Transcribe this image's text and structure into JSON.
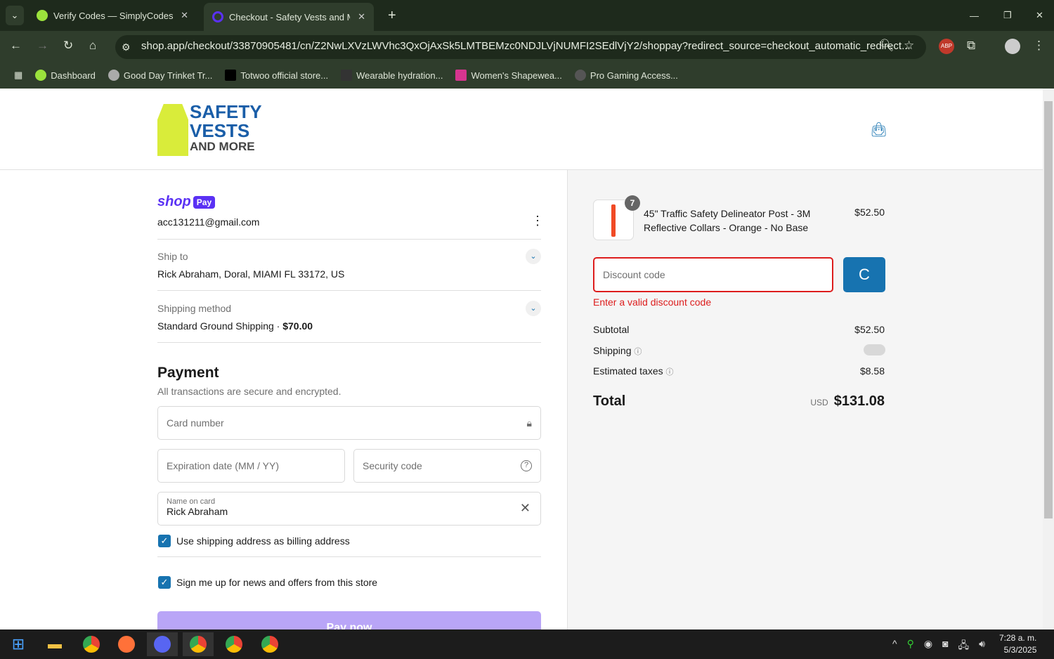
{
  "browser": {
    "tabs": [
      {
        "title": "Verify Codes — SimplyCodes",
        "active": false
      },
      {
        "title": "Checkout - Safety Vests and Mo",
        "active": true
      }
    ],
    "url": "shop.app/checkout/33870905481/cn/Z2NwLXVzLWVhc3QxOjAxSk5LMTBEMzc0NDJLVjNUMFI2SEdlVjY2/shoppay?redirect_source=checkout_automatic_redirect...",
    "bookmarks": [
      "Dashboard",
      "Good Day Trinket Tr...",
      "Totwoo official store...",
      "Wearable hydration...",
      "Women's Shapewea...",
      "Pro Gaming Access..."
    ]
  },
  "store": {
    "logo_line1": "SAFETY",
    "logo_line2": "VESTS",
    "logo_line3": "AND MORE"
  },
  "shoppay": {
    "brand": "shop",
    "badge": "Pay",
    "email": "acc131211@gmail.com"
  },
  "ship_to": {
    "label": "Ship to",
    "value": "Rick Abraham, Doral, MIAMI FL 33172, US"
  },
  "shipping_method": {
    "label": "Shipping method",
    "value": "Standard Ground Shipping · ",
    "price": "$70.00"
  },
  "payment": {
    "title": "Payment",
    "subtitle": "All transactions are secure and encrypted.",
    "card_placeholder": "Card number",
    "expiry_placeholder": "Expiration date (MM / YY)",
    "security_placeholder": "Security code",
    "name_label": "Name on card",
    "name_value": "Rick Abraham",
    "billing_checkbox": "Use shipping address as billing address",
    "news_checkbox": "Sign me up for news and offers from this store",
    "pay_button": "Pay now"
  },
  "summary": {
    "item": {
      "qty": "7",
      "title": "45\" Traffic Safety Delineator Post - 3M Reflective Collars - Orange - No Base",
      "price": "$52.50"
    },
    "discount_placeholder": "Discount code",
    "discount_error": "Enter a valid discount code",
    "subtotal_label": "Subtotal",
    "subtotal": "$52.50",
    "shipping_label": "Shipping",
    "taxes_label": "Estimated taxes",
    "taxes": "$8.58",
    "total_label": "Total",
    "currency": "USD",
    "total": "$131.08"
  },
  "colors": {
    "accent": "#1773b0",
    "error": "#dd1d1d",
    "pay_button": "#b9a5f7"
  },
  "taskbar": {
    "time": "7:28 a. m.",
    "date": "5/3/2025"
  }
}
